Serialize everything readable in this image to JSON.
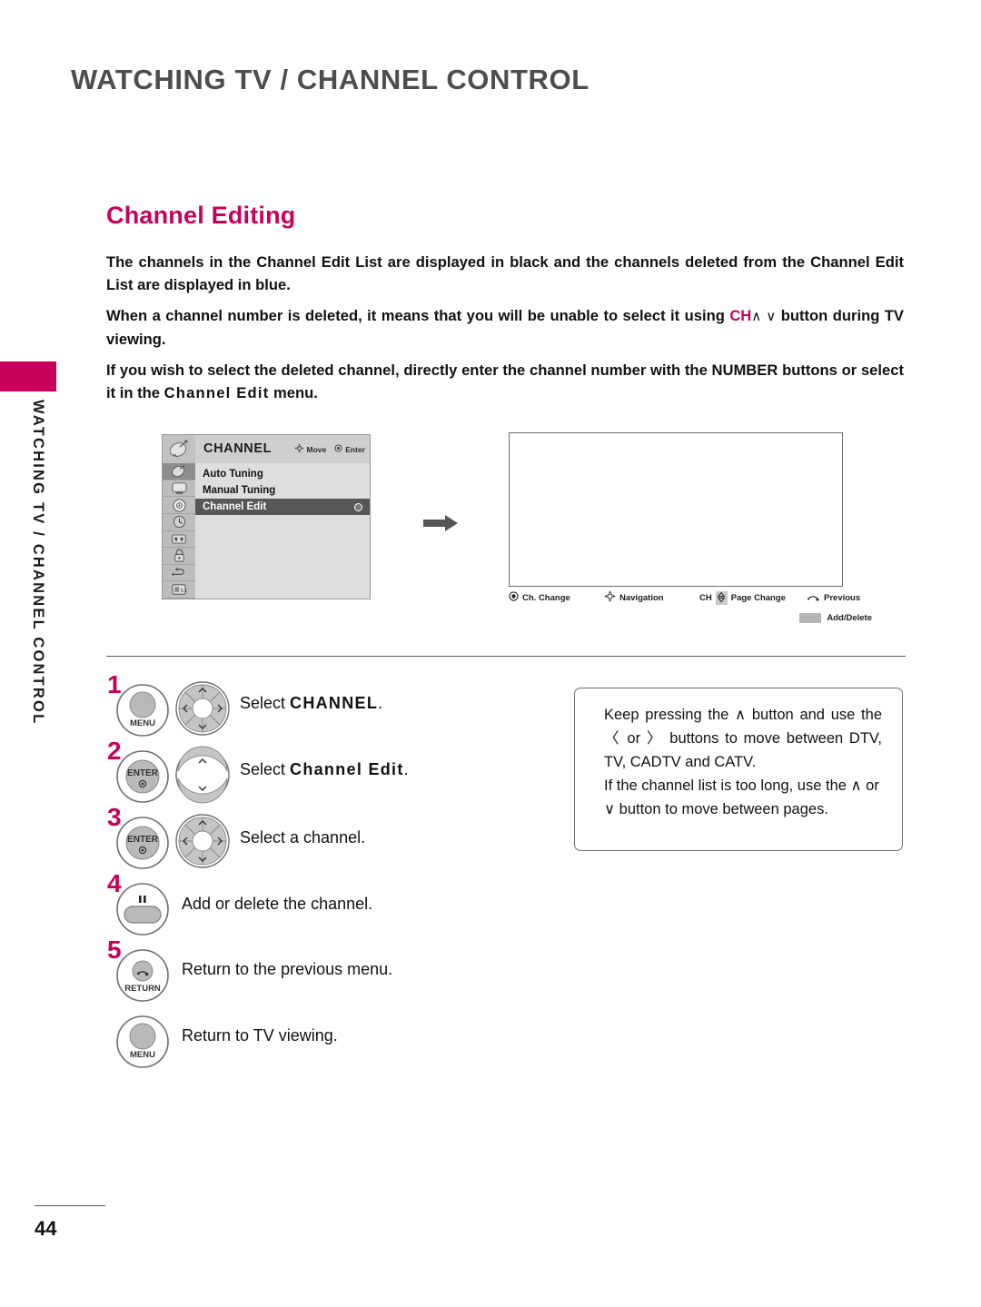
{
  "header": {
    "title": "WATCHING TV / CHANNEL CONTROL"
  },
  "sidebar": {
    "vertical_label": "WATCHING TV / CHANNEL CONTROL",
    "tab_color": "#c8005a"
  },
  "section": {
    "title": "Channel Editing",
    "title_color": "#c8005a"
  },
  "intro": {
    "p1_a": "The channels in the Channel Edit List are displayed in black and the channels deleted from the Channel Edit List are displayed in blue.",
    "p2_a": "When a channel number is deleted, it means that you will be unable to select it using ",
    "p2_accent": "CH",
    "p2_glyph": "∧ ∨",
    "p2_b": " button during TV viewing.",
    "p3_a": "If you wish to select the deleted channel, directly enter the channel number with the NUMBER buttons or select it in the ",
    "p3_bold": "Channel Edit",
    "p3_b": " menu."
  },
  "osd": {
    "title": "CHANNEL",
    "hint_move": "Move",
    "hint_enter": "Enter",
    "header_icon": "satellite-dish-icon",
    "rail_icons": [
      "channel-icon",
      "picture-icon",
      "audio-icon",
      "time-icon",
      "option-icon",
      "lock-icon",
      "input-icon",
      "usb-icon"
    ],
    "items": [
      {
        "label": "Auto Tuning",
        "selected": false
      },
      {
        "label": "Manual Tuning",
        "selected": false
      },
      {
        "label": "Channel Edit",
        "selected": true
      }
    ]
  },
  "tv_panel": {
    "legend": [
      {
        "label": "Ch. Change",
        "icon": "enter-circle-icon"
      },
      {
        "label": "Navigation",
        "icon": "four-way-arrow-icon"
      },
      {
        "label": "Page Change",
        "icon": "ch-updown-icon",
        "prefix": "CH"
      },
      {
        "label": "Previous",
        "icon": "return-arrow-icon"
      },
      {
        "label": "Add/Delete",
        "icon": "gray-key-icon"
      }
    ]
  },
  "steps": [
    {
      "num": "1",
      "button": "MENU",
      "button_type": "round-menu",
      "pad": "dpad-four-way",
      "text_prefix": "Select ",
      "text_bold": "CHANNEL",
      "text_suffix": "."
    },
    {
      "num": "2",
      "button": "ENTER",
      "button_type": "round-enter",
      "pad": "updown-arrows",
      "text_prefix": "Select ",
      "text_bold": "Channel Edit",
      "text_suffix": "."
    },
    {
      "num": "3",
      "button": "ENTER",
      "button_type": "round-enter",
      "pad": "dpad-four-way",
      "text_prefix": "Select a channel.",
      "text_bold": "",
      "text_suffix": ""
    },
    {
      "num": "4",
      "button": "",
      "button_type": "pause-bar",
      "pad": "",
      "text_prefix": "Add or delete the channel.",
      "text_bold": "",
      "text_suffix": ""
    },
    {
      "num": "5",
      "button": "RETURN",
      "button_type": "round-return",
      "pad": "",
      "text_prefix": "Return to the previous menu.",
      "text_bold": "",
      "text_suffix": ""
    },
    {
      "num": "",
      "button": "MENU",
      "button_type": "round-menu",
      "pad": "",
      "text_prefix": "Return to TV viewing.",
      "text_bold": "",
      "text_suffix": ""
    }
  ],
  "note": {
    "line1": "Keep pressing the ∧ button and use the 〈 or 〉 buttons to move between DTV, TV, CADTV and CATV.",
    "line2": "If the channel list is too long, use the ∧ or ∨ button to move between pages."
  },
  "footer": {
    "page_number": "44"
  }
}
